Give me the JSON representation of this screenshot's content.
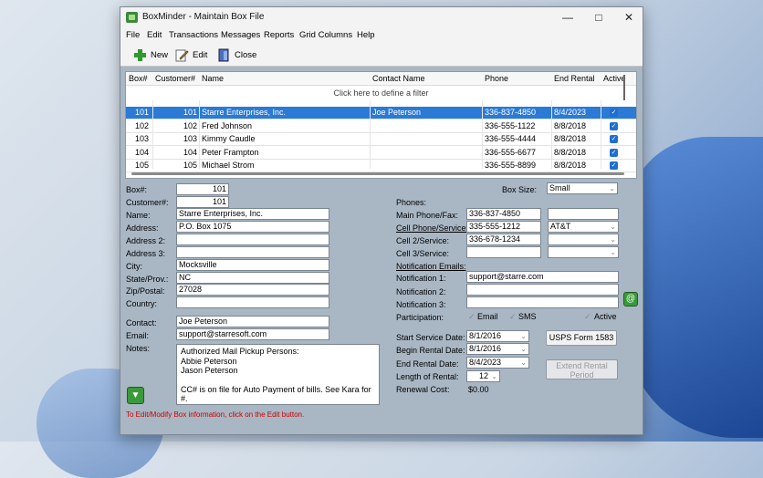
{
  "window": {
    "title": "BoxMinder - Maintain Box File"
  },
  "menu": [
    "File",
    "Edit",
    "Transactions",
    "Messages",
    "Reports",
    "Grid Columns",
    "Help"
  ],
  "toolbar": {
    "new": "New",
    "edit": "Edit",
    "close": "Close"
  },
  "grid": {
    "headers": [
      "Box#",
      "Customer#",
      "Name",
      "Contact Name",
      "Phone",
      "End Rental",
      "Active"
    ],
    "filter_text": "Click here to define a filter",
    "rows": [
      {
        "box": "101",
        "cust": "101",
        "name": "Starre Enterprises, Inc.",
        "contact": "Joe Peterson",
        "phone": "336-837-4850",
        "end": "8/4/2023"
      },
      {
        "box": "102",
        "cust": "102",
        "name": "Fred Johnson",
        "contact": "",
        "phone": "336-555-1122",
        "end": "8/8/2018"
      },
      {
        "box": "103",
        "cust": "103",
        "name": "Kimmy Caudle",
        "contact": "",
        "phone": "336-555-4444",
        "end": "8/8/2018"
      },
      {
        "box": "104",
        "cust": "104",
        "name": "Peter Frampton",
        "contact": "",
        "phone": "336-555-6677",
        "end": "8/8/2018"
      },
      {
        "box": "105",
        "cust": "105",
        "name": "Michael Strom",
        "contact": "",
        "phone": "336-555-8899",
        "end": "8/8/2018"
      }
    ]
  },
  "labels": {
    "box": "Box#:",
    "customer": "Customer#:",
    "name": "Name:",
    "address": "Address:",
    "address2": "Address 2:",
    "address3": "Address 3:",
    "city": "City:",
    "state": "State/Prov.:",
    "zip": "Zip/Postal:",
    "country": "Country:",
    "contact": "Contact:",
    "email": "Email:",
    "notes": "Notes:",
    "box_size": "Box Size:",
    "phones": "Phones:",
    "main_phone": "Main Phone/Fax:",
    "cell_phone": "Cell Phone/Service:",
    "cell2": "Cell 2/Service:",
    "cell3": "Cell 3/Service:",
    "notif_emails": "Notification Emails:",
    "notif1": "Notification 1:",
    "notif2": "Notification 2:",
    "notif3": "Notification 3:",
    "participation": "Participation:",
    "part_email": "Email",
    "part_sms": "SMS",
    "part_active": "Active",
    "start_date": "Start Service Date:",
    "begin_date": "Begin Rental Date:",
    "end_date": "End Rental Date:",
    "length": "Length of Rental:",
    "renewal": "Renewal Cost:"
  },
  "values": {
    "box": "101",
    "customer": "101",
    "name": "Starre Enterprises, Inc.",
    "address": "P.O. Box 1075",
    "address2": "",
    "address3": "",
    "city": "Mocksville",
    "state": "NC",
    "zip": "27028",
    "country": "",
    "contact": "Joe Peterson",
    "email": "support@starresoft.com",
    "notes_lines": [
      "Authorized Mail Pickup Persons:",
      "Abbie Peterson",
      "Jason Peterson",
      "",
      "CC# is on file for Auto Payment of bills.  See Kara for",
      "#."
    ],
    "box_size": "Small",
    "main_phone": "336-837-4850",
    "cell_phone": "335-555-1212",
    "cell_service": "AT&T",
    "cell2": "336-678-1234",
    "notif1": "support@starre.com",
    "notif2": "",
    "notif3": "",
    "start_date": "8/1/2016",
    "begin_date": "8/1/2016",
    "end_date": "8/4/2023",
    "length": "12",
    "renewal": "$0.00"
  },
  "buttons": {
    "usps": "USPS Form 1583",
    "extend": "Extend Rental Period"
  },
  "hint": "To Edit/Modify Box information, click on the Edit button."
}
